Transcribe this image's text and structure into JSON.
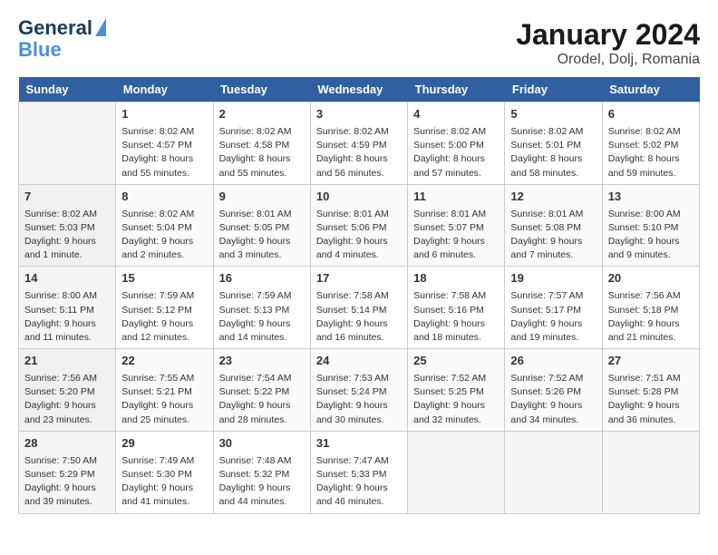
{
  "header": {
    "logo_line1": "General",
    "logo_line2": "Blue",
    "month_year": "January 2024",
    "location": "Orodel, Dolj, Romania"
  },
  "days_of_week": [
    "Sunday",
    "Monday",
    "Tuesday",
    "Wednesday",
    "Thursday",
    "Friday",
    "Saturday"
  ],
  "weeks": [
    [
      {
        "num": "",
        "info": ""
      },
      {
        "num": "1",
        "info": "Sunrise: 8:02 AM\nSunset: 4:57 PM\nDaylight: 8 hours\nand 55 minutes."
      },
      {
        "num": "2",
        "info": "Sunrise: 8:02 AM\nSunset: 4:58 PM\nDaylight: 8 hours\nand 55 minutes."
      },
      {
        "num": "3",
        "info": "Sunrise: 8:02 AM\nSunset: 4:59 PM\nDaylight: 8 hours\nand 56 minutes."
      },
      {
        "num": "4",
        "info": "Sunrise: 8:02 AM\nSunset: 5:00 PM\nDaylight: 8 hours\nand 57 minutes."
      },
      {
        "num": "5",
        "info": "Sunrise: 8:02 AM\nSunset: 5:01 PM\nDaylight: 8 hours\nand 58 minutes."
      },
      {
        "num": "6",
        "info": "Sunrise: 8:02 AM\nSunset: 5:02 PM\nDaylight: 8 hours\nand 59 minutes."
      }
    ],
    [
      {
        "num": "7",
        "info": "Sunrise: 8:02 AM\nSunset: 5:03 PM\nDaylight: 9 hours\nand 1 minute."
      },
      {
        "num": "8",
        "info": "Sunrise: 8:02 AM\nSunset: 5:04 PM\nDaylight: 9 hours\nand 2 minutes."
      },
      {
        "num": "9",
        "info": "Sunrise: 8:01 AM\nSunset: 5:05 PM\nDaylight: 9 hours\nand 3 minutes."
      },
      {
        "num": "10",
        "info": "Sunrise: 8:01 AM\nSunset: 5:06 PM\nDaylight: 9 hours\nand 4 minutes."
      },
      {
        "num": "11",
        "info": "Sunrise: 8:01 AM\nSunset: 5:07 PM\nDaylight: 9 hours\nand 6 minutes."
      },
      {
        "num": "12",
        "info": "Sunrise: 8:01 AM\nSunset: 5:08 PM\nDaylight: 9 hours\nand 7 minutes."
      },
      {
        "num": "13",
        "info": "Sunrise: 8:00 AM\nSunset: 5:10 PM\nDaylight: 9 hours\nand 9 minutes."
      }
    ],
    [
      {
        "num": "14",
        "info": "Sunrise: 8:00 AM\nSunset: 5:11 PM\nDaylight: 9 hours\nand 11 minutes."
      },
      {
        "num": "15",
        "info": "Sunrise: 7:59 AM\nSunset: 5:12 PM\nDaylight: 9 hours\nand 12 minutes."
      },
      {
        "num": "16",
        "info": "Sunrise: 7:59 AM\nSunset: 5:13 PM\nDaylight: 9 hours\nand 14 minutes."
      },
      {
        "num": "17",
        "info": "Sunrise: 7:58 AM\nSunset: 5:14 PM\nDaylight: 9 hours\nand 16 minutes."
      },
      {
        "num": "18",
        "info": "Sunrise: 7:58 AM\nSunset: 5:16 PM\nDaylight: 9 hours\nand 18 minutes."
      },
      {
        "num": "19",
        "info": "Sunrise: 7:57 AM\nSunset: 5:17 PM\nDaylight: 9 hours\nand 19 minutes."
      },
      {
        "num": "20",
        "info": "Sunrise: 7:56 AM\nSunset: 5:18 PM\nDaylight: 9 hours\nand 21 minutes."
      }
    ],
    [
      {
        "num": "21",
        "info": "Sunrise: 7:56 AM\nSunset: 5:20 PM\nDaylight: 9 hours\nand 23 minutes."
      },
      {
        "num": "22",
        "info": "Sunrise: 7:55 AM\nSunset: 5:21 PM\nDaylight: 9 hours\nand 25 minutes."
      },
      {
        "num": "23",
        "info": "Sunrise: 7:54 AM\nSunset: 5:22 PM\nDaylight: 9 hours\nand 28 minutes."
      },
      {
        "num": "24",
        "info": "Sunrise: 7:53 AM\nSunset: 5:24 PM\nDaylight: 9 hours\nand 30 minutes."
      },
      {
        "num": "25",
        "info": "Sunrise: 7:52 AM\nSunset: 5:25 PM\nDaylight: 9 hours\nand 32 minutes."
      },
      {
        "num": "26",
        "info": "Sunrise: 7:52 AM\nSunset: 5:26 PM\nDaylight: 9 hours\nand 34 minutes."
      },
      {
        "num": "27",
        "info": "Sunrise: 7:51 AM\nSunset: 5:28 PM\nDaylight: 9 hours\nand 36 minutes."
      }
    ],
    [
      {
        "num": "28",
        "info": "Sunrise: 7:50 AM\nSunset: 5:29 PM\nDaylight: 9 hours\nand 39 minutes."
      },
      {
        "num": "29",
        "info": "Sunrise: 7:49 AM\nSunset: 5:30 PM\nDaylight: 9 hours\nand 41 minutes."
      },
      {
        "num": "30",
        "info": "Sunrise: 7:48 AM\nSunset: 5:32 PM\nDaylight: 9 hours\nand 44 minutes."
      },
      {
        "num": "31",
        "info": "Sunrise: 7:47 AM\nSunset: 5:33 PM\nDaylight: 9 hours\nand 46 minutes."
      },
      {
        "num": "",
        "info": ""
      },
      {
        "num": "",
        "info": ""
      },
      {
        "num": "",
        "info": ""
      }
    ]
  ]
}
